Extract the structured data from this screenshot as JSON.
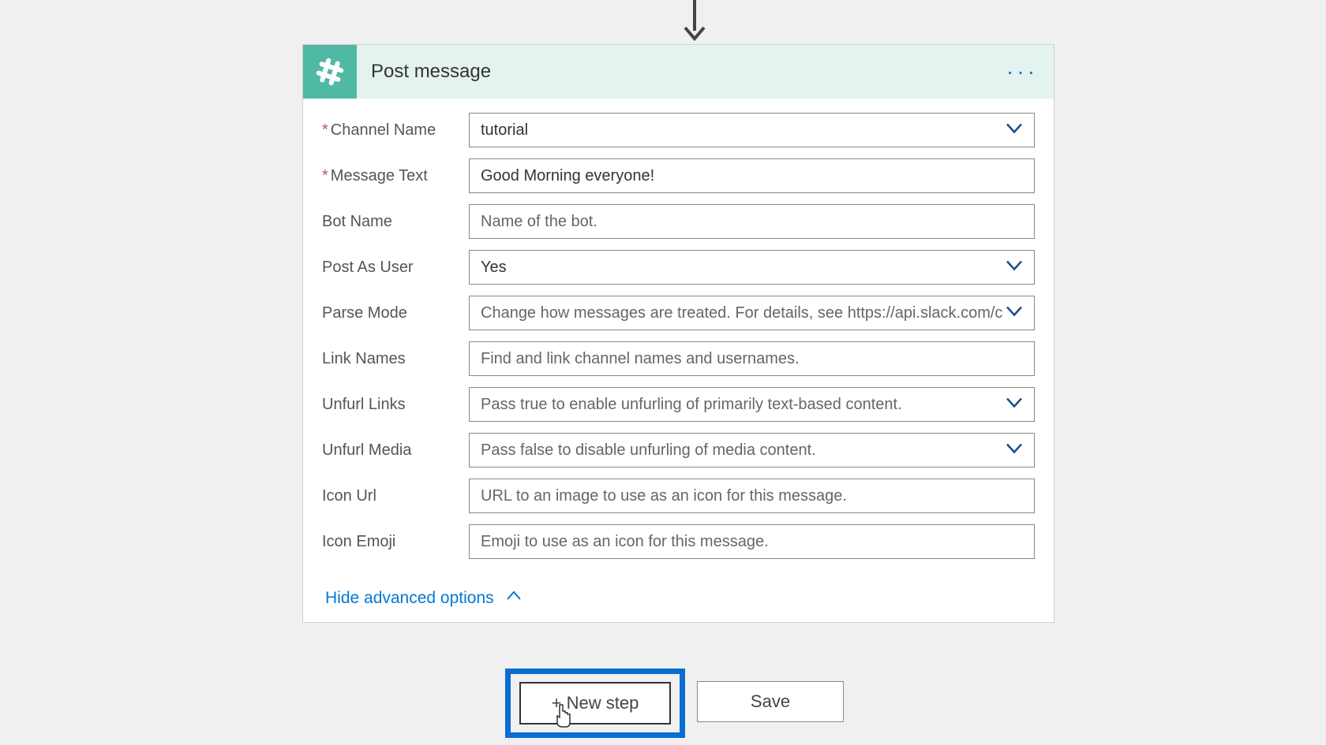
{
  "card": {
    "title": "Post message",
    "toggle": "Hide advanced options",
    "fields": {
      "channel": {
        "label": "Channel Name",
        "value": "tutorial"
      },
      "message": {
        "label": "Message Text",
        "value": "Good Morning everyone!"
      },
      "bot": {
        "label": "Bot Name",
        "placeholder": "Name of the bot."
      },
      "postas": {
        "label": "Post As User",
        "value": "Yes"
      },
      "parse": {
        "label": "Parse Mode",
        "placeholder": "Change how messages are treated. For details, see https://api.slack.com/c"
      },
      "linknames": {
        "label": "Link Names",
        "placeholder": "Find and link channel names and usernames."
      },
      "unfurll": {
        "label": "Unfurl Links",
        "placeholder": "Pass true to enable unfurling of primarily text-based content."
      },
      "unfurlm": {
        "label": "Unfurl Media",
        "placeholder": "Pass false to disable unfurling of media content."
      },
      "iconurl": {
        "label": "Icon Url",
        "placeholder": "URL to an image to use as an icon for this message."
      },
      "iconemoji": {
        "label": "Icon Emoji",
        "placeholder": "Emoji to use as an icon for this message."
      }
    }
  },
  "actions": {
    "newstep": "+ New step",
    "save": "Save"
  }
}
